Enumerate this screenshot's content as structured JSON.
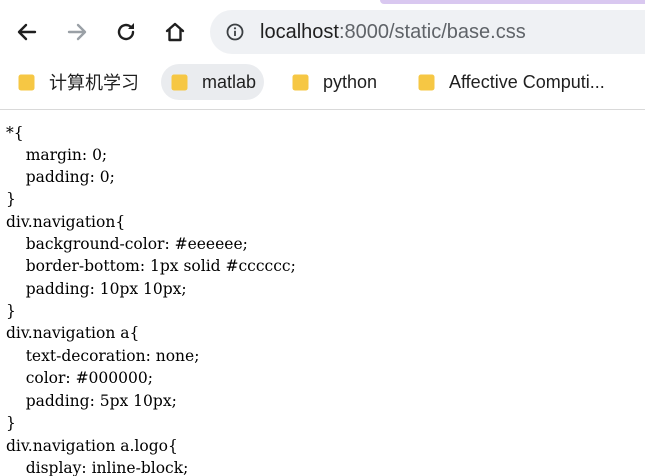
{
  "browser": {
    "url_host": "localhost",
    "url_path": ":8000/static/base.css",
    "icons": {
      "back": "arrow-left-icon",
      "forward": "arrow-right-icon",
      "reload": "reload-icon",
      "home": "home-icon",
      "site_info": "info-icon",
      "bookmark_folder": "folder-icon"
    },
    "colors": {
      "folder": "#f6c744",
      "omnibox_bg": "#eff1f4",
      "active_bookmark_bg": "#eaecef"
    }
  },
  "bookmarks": [
    {
      "label": "计算机学习"
    },
    {
      "label": "matlab"
    },
    {
      "label": "python"
    },
    {
      "label": "Affective Computi..."
    }
  ],
  "code_lines": [
    "*{",
    "    margin: 0;",
    "    padding: 0;",
    "}",
    "div.navigation{",
    "    background-color: #eeeeee;",
    "    border-bottom: 1px solid #cccccc;",
    "    padding: 10px 10px;",
    "}",
    "div.navigation a{",
    "    text-decoration: none;",
    "    color: #000000;",
    "    padding: 5px 10px;",
    "}",
    "div.navigation a.logo{",
    "    display: inline-block;"
  ]
}
